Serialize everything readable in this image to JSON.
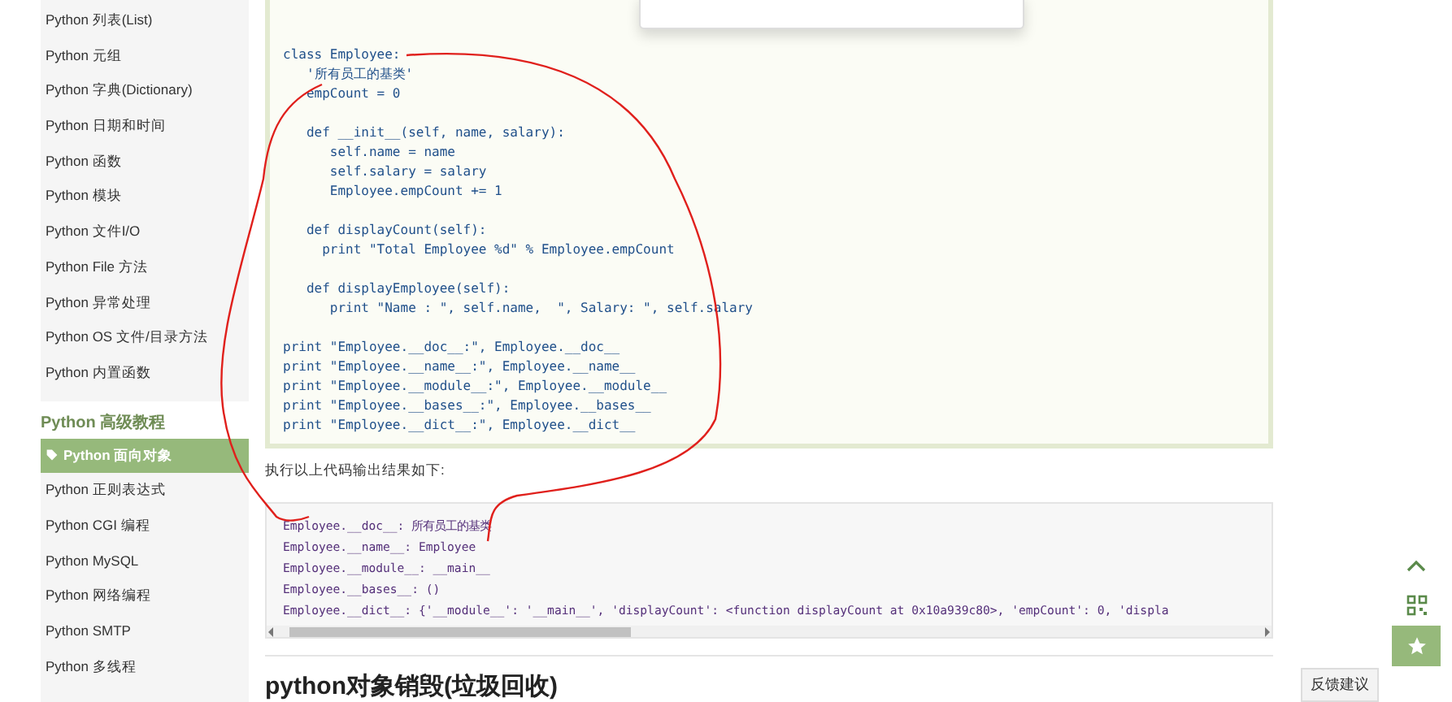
{
  "sidebar": {
    "items": [
      {
        "label": "Python 列表(List)",
        "selected": false
      },
      {
        "label": "Python 元组",
        "selected": false
      },
      {
        "label": "Python 字典(Dictionary)",
        "selected": false
      },
      {
        "label": "Python 日期和时间",
        "selected": false
      },
      {
        "label": "Python 函数",
        "selected": false
      },
      {
        "label": "Python 模块",
        "selected": false
      },
      {
        "label": "Python 文件I/O",
        "selected": false
      },
      {
        "label": "Python File 方法",
        "selected": false
      },
      {
        "label": "Python 异常处理",
        "selected": false
      },
      {
        "label": "Python OS 文件/目录方法",
        "selected": false
      },
      {
        "label": "Python 内置函数",
        "selected": false
      }
    ],
    "section_title": "Python 高级教程",
    "section_items": [
      {
        "label": "Python 面向对象",
        "selected": true
      },
      {
        "label": "Python 正则表达式",
        "selected": false
      },
      {
        "label": "Python CGI 编程",
        "selected": false
      },
      {
        "label": "Python MySQL",
        "selected": false
      },
      {
        "label": "Python 网络编程",
        "selected": false
      },
      {
        "label": "Python SMTP",
        "selected": false
      },
      {
        "label": "Python 多线程",
        "selected": false
      }
    ]
  },
  "code_block": {
    "paragraphs": [
      [
        "class Employee:",
        "   '所有员工的基类'",
        "   empCount = 0"
      ],
      [
        "   def __init__(self, name, salary):",
        "      self.name = name",
        "      self.salary = salary",
        "      Employee.empCount += 1"
      ],
      [
        "   def displayCount(self):",
        "     print \"Total Employee %d\" % Employee.empCount"
      ],
      [
        "   def displayEmployee(self):",
        "      print \"Name : \", self.name,  \", Salary: \", self.salary"
      ],
      [
        "print \"Employee.__doc__:\", Employee.__doc__",
        "print \"Employee.__name__:\", Employee.__name__",
        "print \"Employee.__module__:\", Employee.__module__",
        "print \"Employee.__bases__:\", Employee.__bases__",
        "print \"Employee.__dict__:\", Employee.__dict__"
      ]
    ]
  },
  "output_intro": "执行以上代码输出结果如下:",
  "output_block": {
    "lines": [
      "Employee.__doc__: 所有员工的基类",
      "Employee.__name__: Employee",
      "Employee.__module__: __main__",
      "Employee.__bases__: ()",
      "Employee.__dict__: {'__module__': '__main__', 'displayCount': <function displayCount at 0x10a939c80>, 'empCount': 0, 'displa"
    ]
  },
  "heading": "python对象销毁(垃圾回收)",
  "feedback_button": "反馈建议"
}
